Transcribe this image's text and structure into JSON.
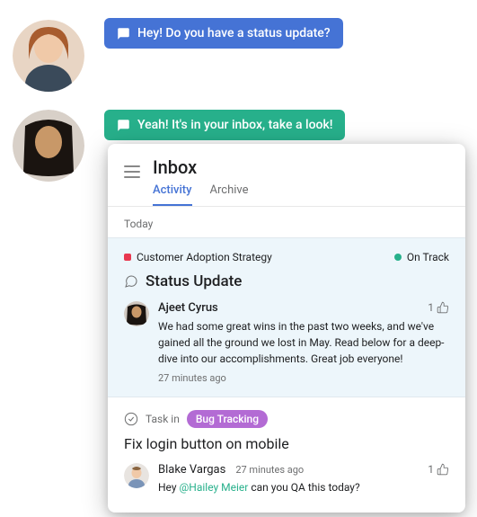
{
  "chat": {
    "msg1": "Hey! Do you have a status update?",
    "msg2": "Yeah! It's in your inbox, take a look!"
  },
  "inbox": {
    "title": "Inbox",
    "tabs": {
      "activity": "Activity",
      "archive": "Archive"
    },
    "today_label": "Today"
  },
  "status_card": {
    "project": "Customer Adoption Strategy",
    "status": "On Track",
    "heading": "Status Update",
    "author": "Ajeet Cyrus",
    "body": "We had some great wins in the past two weeks, and we've gained all the ground we lost in May. Read below for a deep-dive into our accomplishments. Great job everyone!",
    "time": "27 minutes ago",
    "likes": "1"
  },
  "task_card": {
    "meta_label": "Task in",
    "pill": "Bug Tracking",
    "title": "Fix login button on mobile",
    "author": "Blake Vargas",
    "time": "27 minutes ago",
    "prefix": "Hey ",
    "mention": "@Hailey Meier",
    "suffix": " can you QA this today?",
    "likes": "1"
  }
}
